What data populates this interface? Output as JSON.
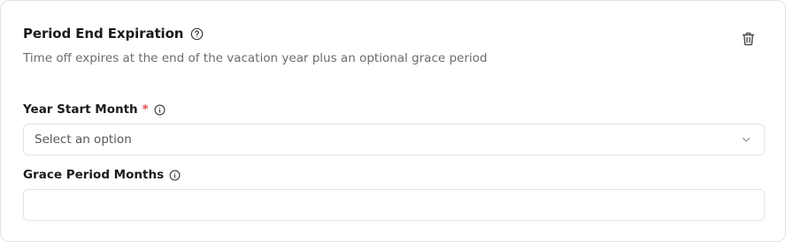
{
  "section": {
    "title": "Period End Expiration",
    "subtitle": "Time off expires at the end of the vacation year plus an optional grace period"
  },
  "fields": {
    "year_start_month": {
      "label": "Year Start Month",
      "required_mark": "*",
      "selected_value": "Select an option"
    },
    "grace_period_months": {
      "label": "Grace Period Months",
      "value": "",
      "placeholder": ""
    }
  },
  "icons": {
    "help": "help-circle-icon",
    "info": "info-icon",
    "delete": "trash-icon",
    "chevron": "chevron-down-icon"
  },
  "colors": {
    "required": "#e5484d",
    "border": "#e2e2e4",
    "muted_text": "#6b6b72"
  }
}
